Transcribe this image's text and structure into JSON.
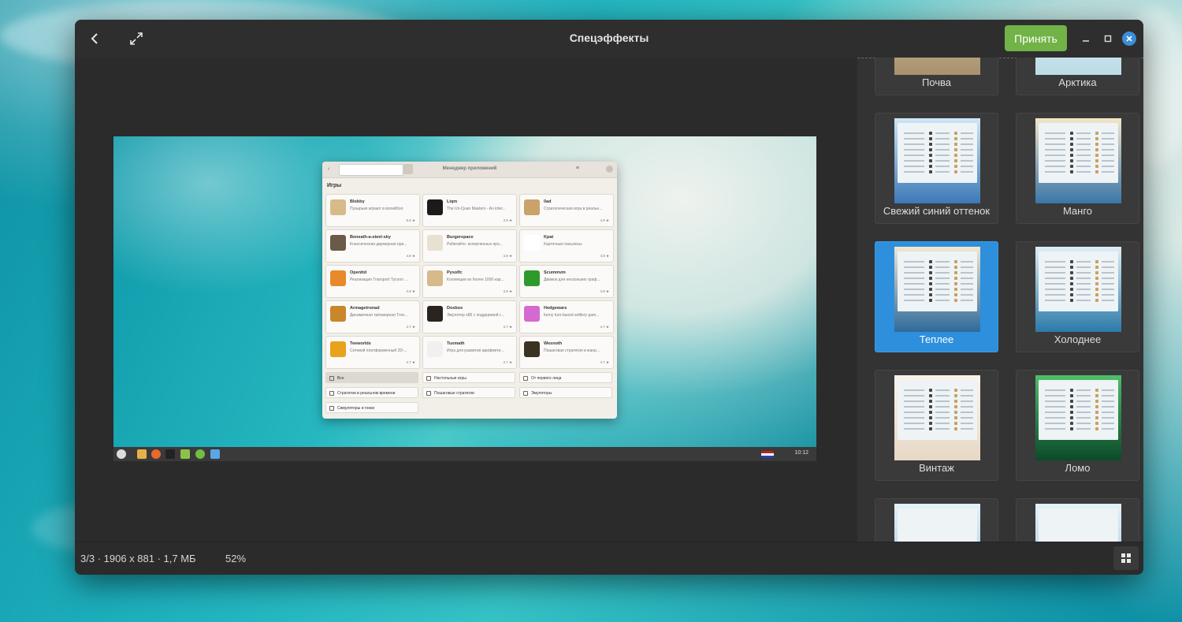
{
  "window": {
    "title": "Спецэффекты",
    "accept_label": "Принять"
  },
  "preview": {
    "app_title": "Менеджер приложений",
    "section": "Игры",
    "apps": [
      {
        "name": "Blobby",
        "desc": "Пузырьки играют в волейбол",
        "rating": "5.5 ★",
        "color": "#d8b98a"
      },
      {
        "name": "Liqm",
        "desc": "The Un-Quan Masters - An inter...",
        "rating": "4.9 ★",
        "color": "#1b1b1b"
      },
      {
        "name": "0ad",
        "desc": "Стратегическая игра в реальн...",
        "rating": "4.9 ★",
        "color": "#c9a36a"
      },
      {
        "name": "Beneath-a-steel-sky",
        "desc": "Классическая двумерная при...",
        "rating": "4.8 ★",
        "color": "#6b5a48"
      },
      {
        "name": "Burgerspace",
        "desc": "Рабегайте: испорченных про...",
        "rating": "4.8 ★",
        "color": "#e8e0d2"
      },
      {
        "name": "Kpat",
        "desc": "Карточные пасьянсы",
        "rating": "4.8 ★",
        "color": "#ffffff"
      },
      {
        "name": "Openttd",
        "desc": "Реализация Transport Tycoon ...",
        "rating": "4.8 ★",
        "color": "#e88a2a"
      },
      {
        "name": "Pysolfc",
        "desc": "Коллекция из более 1000 кар...",
        "rating": "4.8 ★",
        "color": "#d8b98a"
      },
      {
        "name": "Scummvm",
        "desc": "Движок для нескольких граф...",
        "rating": "4.8 ★",
        "color": "#2f9a2c"
      },
      {
        "name": "Armagetronad",
        "desc": "Динамичная трёхмерная Tron...",
        "rating": "4.7 ★",
        "color": "#c9862a"
      },
      {
        "name": "Dosbox",
        "desc": "Эмулятор x86 с поддержкой г...",
        "rating": "4.7 ★",
        "color": "#2a241e"
      },
      {
        "name": "Hedgewars",
        "desc": "funny turn-based artillery gam...",
        "rating": "4.7 ★",
        "color": "#d46ad0"
      },
      {
        "name": "Teeworlds",
        "desc": "Сетевой платформенный 2D-...",
        "rating": "4.7 ★",
        "color": "#e8a21c"
      },
      {
        "name": "Tuxmath",
        "desc": "Игра для развития арифмети...",
        "rating": "4.7 ★",
        "color": "#f0f0f0"
      },
      {
        "name": "Wesnoth",
        "desc": "Пошаговая стратегия в жанр...",
        "rating": "4.7 ★",
        "color": "#3a3322"
      }
    ],
    "categories": [
      "Все",
      "Настольные игры",
      "От первого лица",
      "Стратегии в реальном времени",
      "Пошаговые стратегии",
      "Эмуляторы",
      "Симуляторы и гонки"
    ],
    "clock": "10:12"
  },
  "effects": [
    {
      "label": "Почва",
      "selected": false
    },
    {
      "label": "Арктика",
      "selected": false
    },
    {
      "label": "Свежий синий оттенок",
      "selected": false
    },
    {
      "label": "Манго",
      "selected": false
    },
    {
      "label": "Теплее",
      "selected": true
    },
    {
      "label": "Холоднее",
      "selected": false
    },
    {
      "label": "Винтаж",
      "selected": false
    },
    {
      "label": "Ломо",
      "selected": false
    }
  ],
  "status": {
    "info": "3/3  ·  1906 x 881  ·  1,7 МБ",
    "zoom": "52%"
  },
  "colors": {
    "accept": "#71b346",
    "selected_tile": "#2e8fdc",
    "close": "#3a8ed8"
  }
}
